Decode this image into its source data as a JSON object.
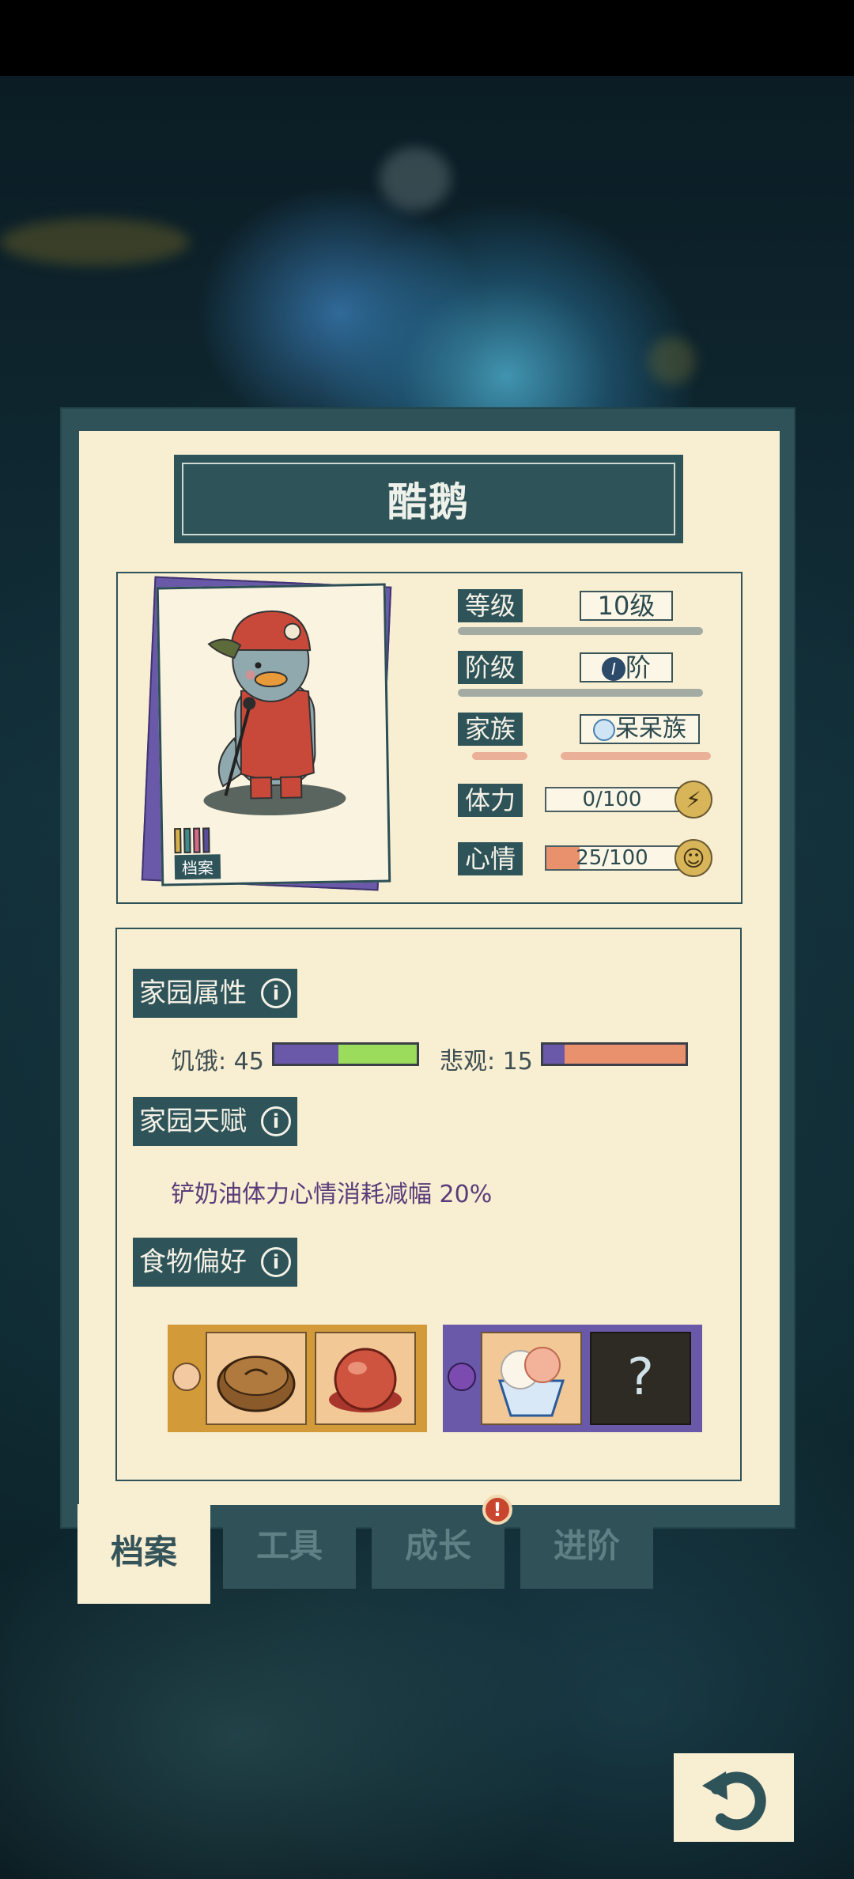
{
  "character": {
    "name": "酷鹅",
    "file_tag": "档案",
    "stats": {
      "level_label": "等级",
      "level_value": "10级",
      "rank_label": "阶级",
      "rank_value": "阶",
      "rank_badge": "I",
      "clan_label": "家族",
      "clan_value": "呆呆族",
      "stamina_label": "体力",
      "stamina_value": "0/100",
      "stamina_fraction": 0.0,
      "mood_label": "心情",
      "mood_value": "25/100",
      "mood_fraction": 0.25
    }
  },
  "home_attributes": {
    "label": "家园属性",
    "hunger_label": "饥饿: 45",
    "hunger_fraction": 0.45,
    "pessimism_label": "悲观: 15",
    "pessimism_fraction": 0.15
  },
  "home_talent": {
    "label": "家园天赋",
    "text": "铲奶油体力心情消耗减幅 20%"
  },
  "food_preference": {
    "label": "食物偏好",
    "liked": [
      "mooncake",
      "red-bean-bun"
    ],
    "disliked": [
      "shaved-ice",
      "unknown"
    ],
    "unknown_mark": "?"
  },
  "tabs": [
    "档案",
    "工具",
    "成长",
    "进阶"
  ],
  "tab_badge": "!",
  "colors": {
    "panel": "#2e5258",
    "paper": "#f8eed2",
    "label_bg": "#2e5459",
    "liked_group": "#d39a3a",
    "disliked_group": "#6a58a8",
    "hunger_fill": "#6a58a8",
    "hunger_rest": "#9bdc5c",
    "pessimism_rest": "#e8916c",
    "mood_fill": "#e8916c"
  },
  "icons": [
    "info-icon",
    "lightning-icon",
    "smile-icon",
    "back-arrow-icon",
    "happy-face-icon",
    "devil-face-icon",
    "penguin-clan-icon"
  ]
}
